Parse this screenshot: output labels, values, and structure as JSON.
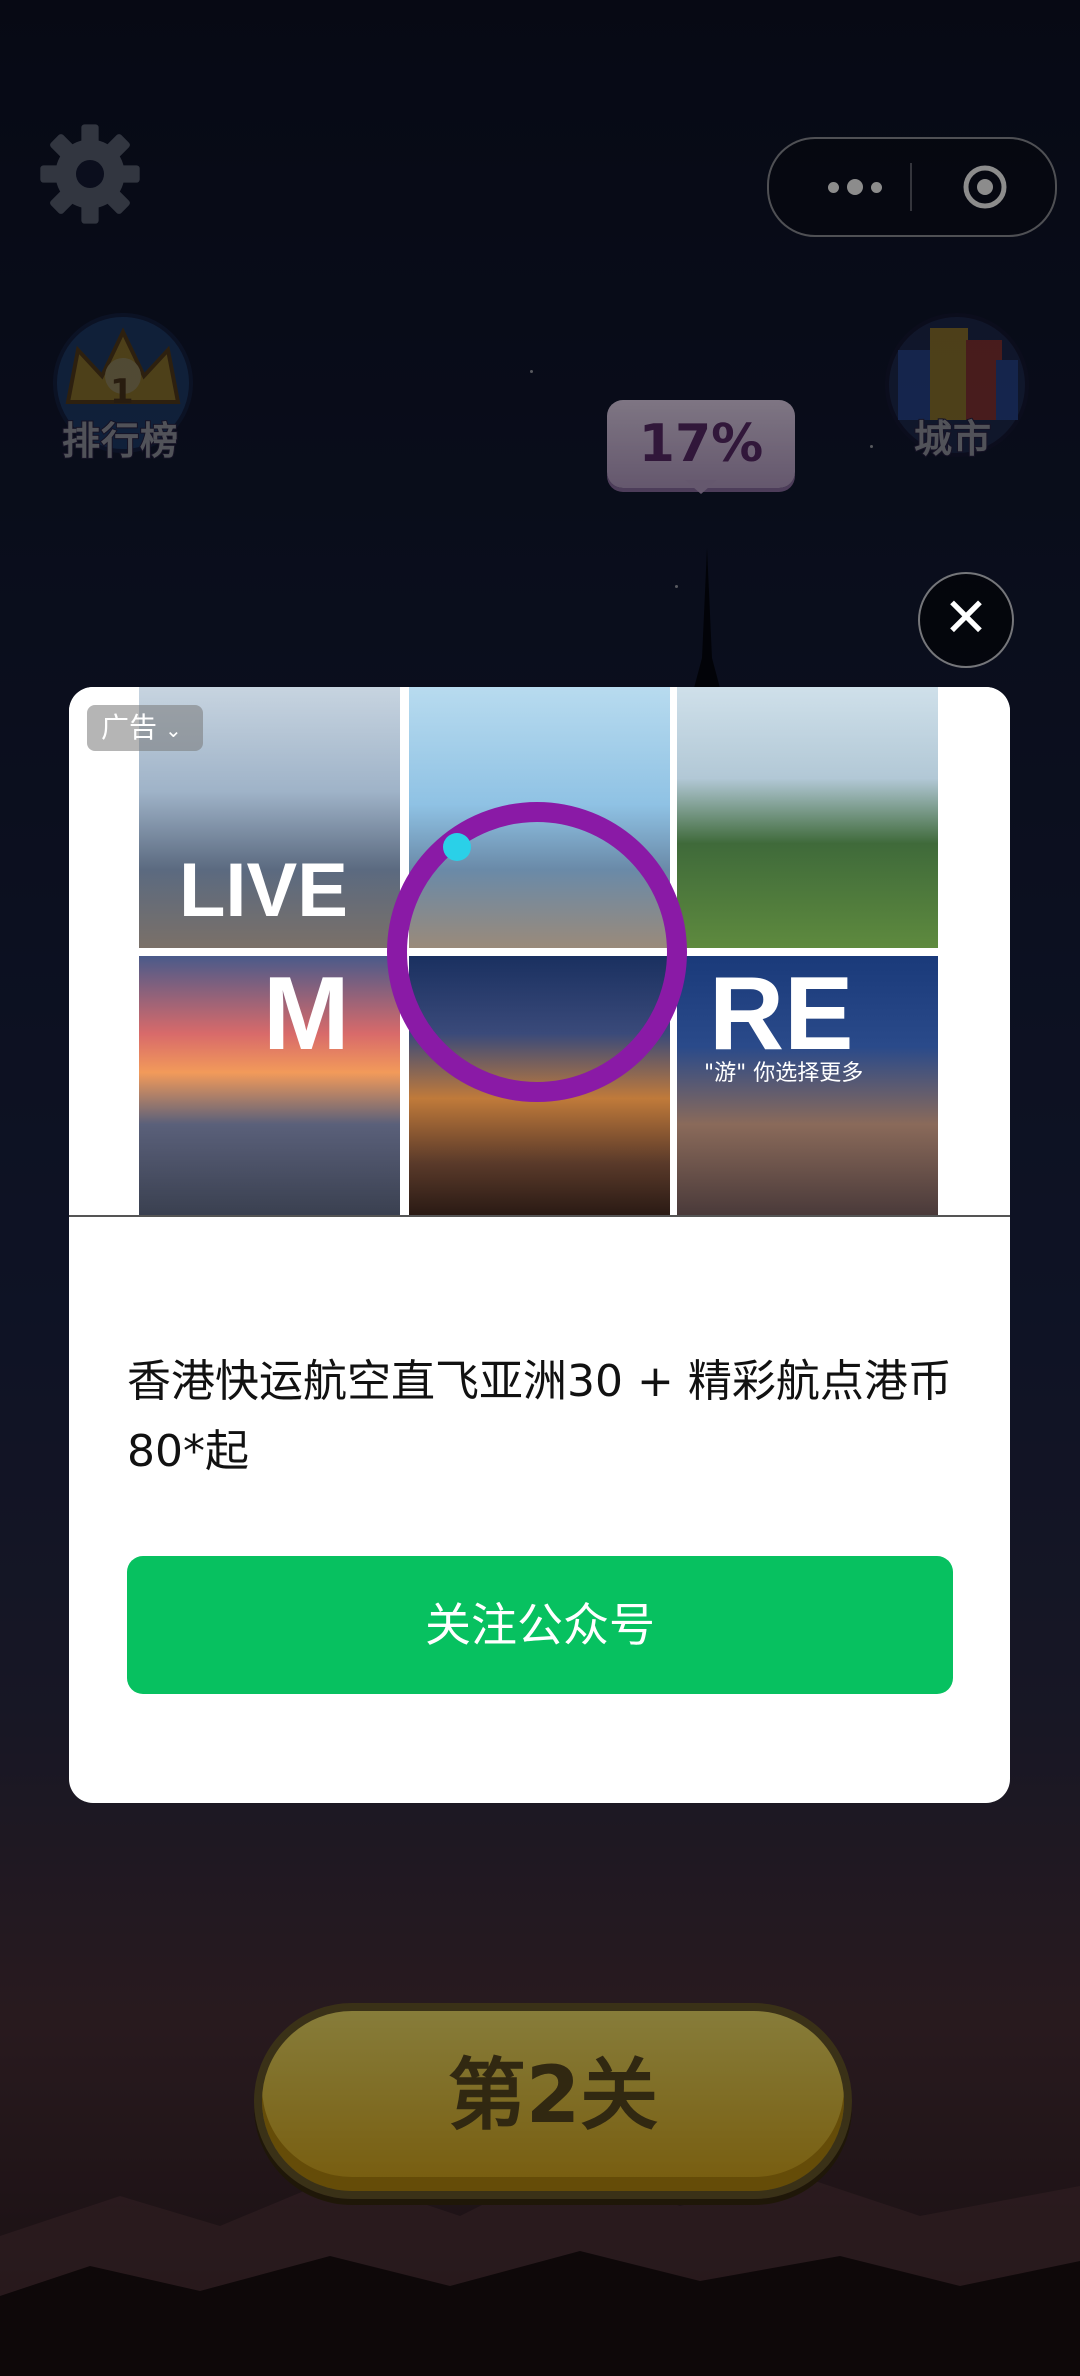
{
  "game": {
    "progress_percent": "17%",
    "leaderboard": {
      "rank": "1",
      "label": "排行榜"
    },
    "city": {
      "label": "城市"
    },
    "level_button": "第2关"
  },
  "ad": {
    "tag": "广告",
    "tag_chevron": "⌄",
    "image_words": {
      "live": "LIVE",
      "m": "M",
      "re": "RE"
    },
    "slogan": "\"游\" 你选择更多",
    "headline": "香港快运航空直飞亚洲30 + 精彩航点港币80*起",
    "cta_label": "关注公众号",
    "close_symbol": "✕"
  },
  "colors": {
    "cta_green": "#07c160",
    "ring_purple": "#8a1aa6",
    "level_yellow": "#f0d040"
  },
  "icons": {
    "settings": "gear-icon",
    "menu": "more-dots-icon",
    "exit": "target-icon",
    "close": "close-icon"
  }
}
